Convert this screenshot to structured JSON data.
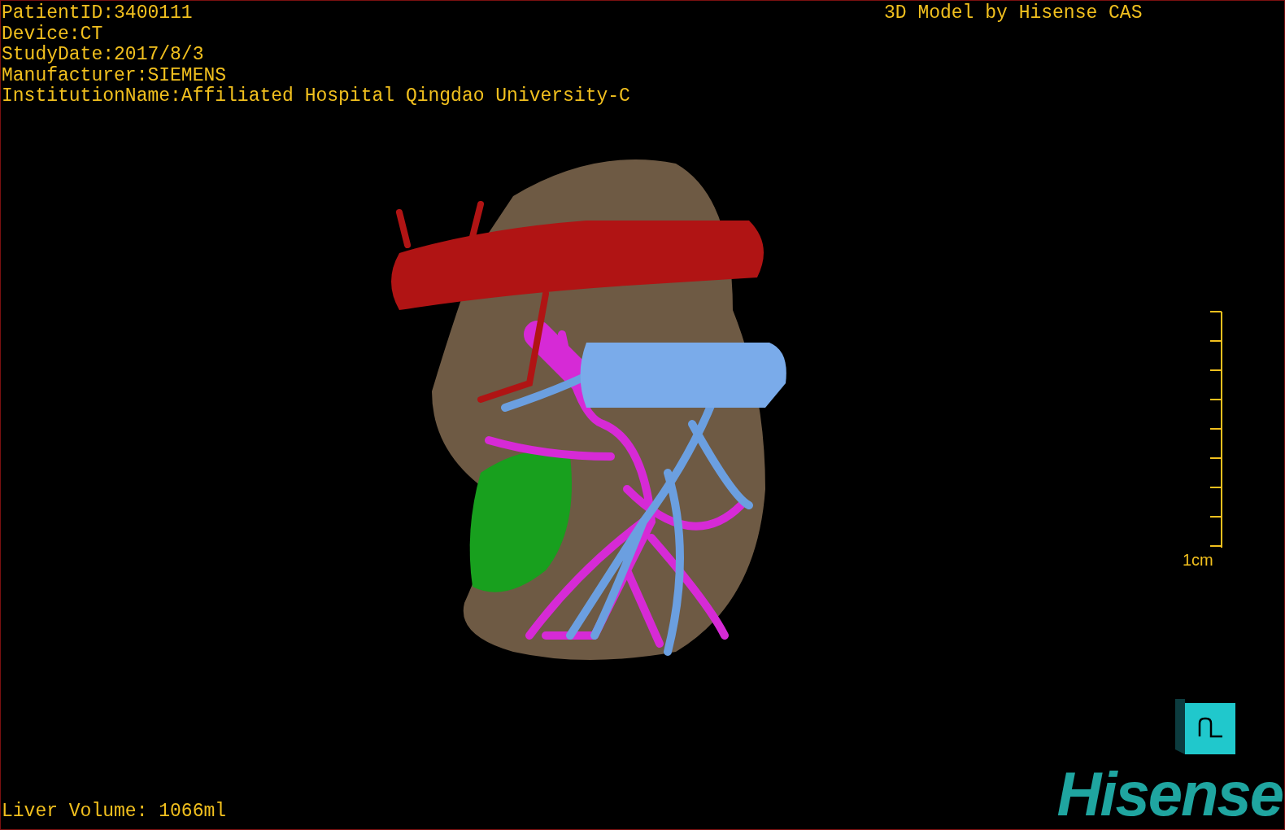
{
  "study_info": [
    "PatientID:3400111",
    "Device:CT",
    "StudyDate:2017/8/3",
    "Manufacturer:SIEMENS",
    "InstitutionName:Affiliated Hospital Qingdao University-C"
  ],
  "model_credit": "3D Model by Hisense CAS",
  "scale_bar": {
    "label": "1cm"
  },
  "liver_volume": "Liver Volume: 1066ml",
  "logo": "Hisense"
}
